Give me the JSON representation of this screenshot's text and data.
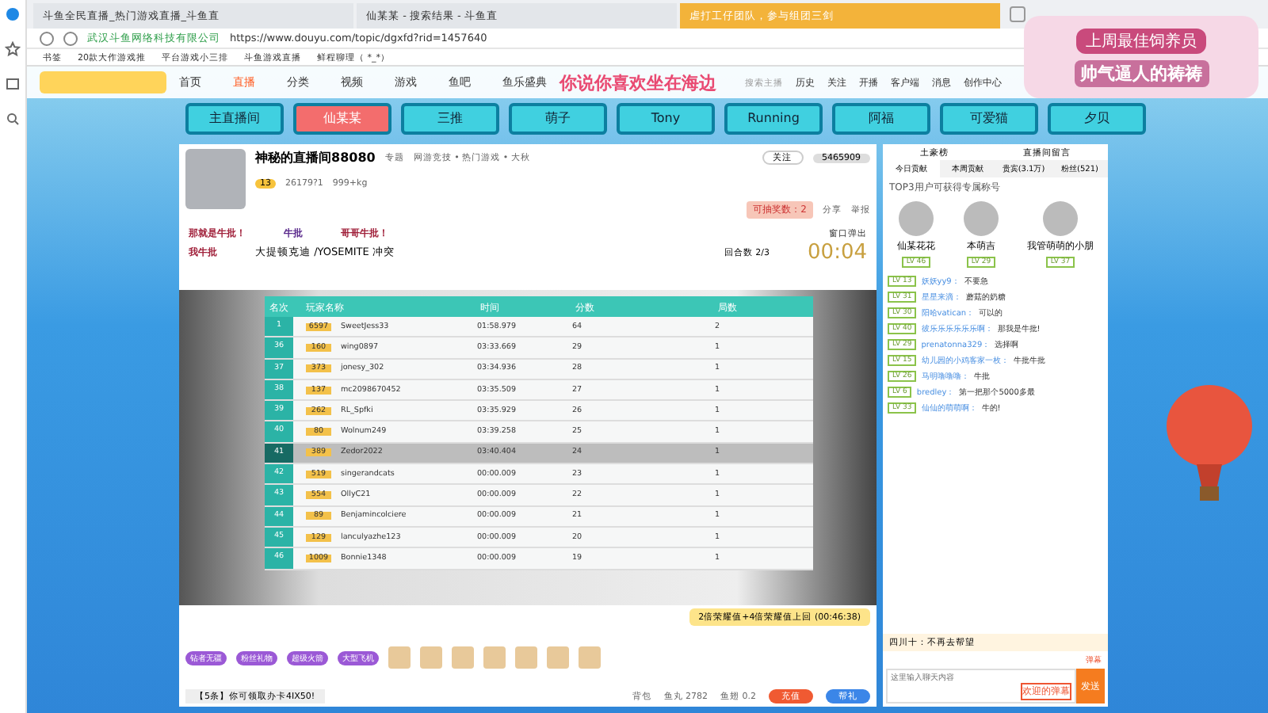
{
  "browser": {
    "tabs": [
      {
        "title": "斗鱼全民直播_热门游戏直播_斗鱼直",
        "selected": false
      },
      {
        "title": "仙某某 - 搜索结果 - 斗鱼直",
        "selected": false
      },
      {
        "title": "虐打工仔团队，参与组团三剑",
        "selected": true
      }
    ],
    "site_owner": "武汉斗鱼网络科技有限公司",
    "url": "https://www.douyu.com/topic/dgxfd?rid=1457640",
    "bookmarks": [
      "书签",
      "20款大作游戏推",
      "平台游戏小三排",
      "斗鱼游戏直播",
      "鲜程聊理（ *_*）"
    ]
  },
  "overlay": {
    "caption": "你说你喜欢坐在海边",
    "badge_title": "上周最佳饲养员",
    "badge_name": "帅气逼人的祷祷"
  },
  "site_nav": {
    "items": [
      {
        "label": "首页",
        "selected": false
      },
      {
        "label": "直播",
        "selected": true
      },
      {
        "label": "分类",
        "selected": false
      },
      {
        "label": "视频",
        "selected": false
      },
      {
        "label": "游戏",
        "selected": false
      },
      {
        "label": "鱼吧",
        "selected": false
      },
      {
        "label": "鱼乐盛典",
        "selected": false
      }
    ],
    "search_placeholder": "搜索主播",
    "actions": [
      "历史",
      "关注",
      "开播",
      "客户端",
      "消息",
      "创作中心"
    ]
  },
  "anchor_tabs": [
    {
      "label": "主直播间",
      "selected": false
    },
    {
      "label": "仙某某",
      "selected": true
    },
    {
      "label": "三推",
      "selected": false
    },
    {
      "label": "萌子",
      "selected": false
    },
    {
      "label": "Tony",
      "selected": false
    },
    {
      "label": "Running",
      "selected": false
    },
    {
      "label": "阿福",
      "selected": false
    },
    {
      "label": "可爱猫",
      "selected": false
    },
    {
      "label": "夕贝",
      "selected": false
    }
  ],
  "room": {
    "title": "神秘的直播间88080",
    "tag": "专题",
    "category": "网游竞技 • 热门游戏 • 大秋",
    "level": "13",
    "heat": "26179?1",
    "follow": "关注",
    "report": "举报",
    "share": "分享",
    "fans_count": "5465909",
    "stat_weight": "999+kg",
    "notice": "可抽奖数：2"
  },
  "game": {
    "banner_left": "那就是牛批！",
    "banner_mid": "牛批",
    "banner_right": "哥哥牛批！",
    "label_left": "我牛批",
    "map": "大提顿克迪 /YOSEMITE 冲突",
    "round": "回合数 2/3",
    "timer": "00:04",
    "popout": "窗口弹出",
    "columns": [
      "名次",
      "玩家名称",
      "时间",
      "分数",
      "局数"
    ],
    "rows": [
      {
        "rank": "1",
        "level": "6597",
        "name": "SweetJess33",
        "time": "01:58.979",
        "score": "64",
        "count": "2",
        "selected": false
      },
      {
        "rank": "36",
        "level": "160",
        "name": "wing0897",
        "time": "03:33.669",
        "score": "29",
        "count": "1",
        "selected": false
      },
      {
        "rank": "37",
        "level": "373",
        "name": "jonesy_302",
        "time": "03:34.936",
        "score": "28",
        "count": "1",
        "selected": false
      },
      {
        "rank": "38",
        "level": "137",
        "name": "mc2098670452",
        "time": "03:35.509",
        "score": "27",
        "count": "1",
        "selected": false
      },
      {
        "rank": "39",
        "level": "262",
        "name": "RL_Spfki",
        "time": "03:35.929",
        "score": "26",
        "count": "1",
        "selected": false
      },
      {
        "rank": "40",
        "level": "80",
        "name": "Wolnum249",
        "time": "03:39.258",
        "score": "25",
        "count": "1",
        "selected": false
      },
      {
        "rank": "41",
        "level": "389",
        "name": "Zedor2022",
        "time": "03:40.404",
        "score": "24",
        "count": "1",
        "selected": true
      },
      {
        "rank": "42",
        "level": "519",
        "name": "singerandcats",
        "time": "00:00.009",
        "score": "23",
        "count": "1",
        "selected": false
      },
      {
        "rank": "43",
        "level": "554",
        "name": "OllyC21",
        "time": "00:00.009",
        "score": "22",
        "count": "1",
        "selected": false
      },
      {
        "rank": "44",
        "level": "89",
        "name": "Benjamincolciere",
        "time": "00:00.009",
        "score": "21",
        "count": "1",
        "selected": false
      },
      {
        "rank": "45",
        "level": "129",
        "name": "lanculyazhe123",
        "time": "00:00.009",
        "score": "20",
        "count": "1",
        "selected": false
      },
      {
        "rank": "46",
        "level": "1009",
        "name": "Bonnie1348",
        "time": "00:00.009",
        "score": "19",
        "count": "1",
        "selected": false
      }
    ]
  },
  "gift_bar": {
    "promo": "2倍荣耀值+4倍荣耀值上回 (00:46:38)",
    "notice": "【5条】你可领取办卡4IX50!",
    "gifts": [
      "钻者无疆",
      "粉丝礼物",
      "超级火箭",
      "大型飞机"
    ],
    "backpack": "背包",
    "coins": "鱼丸 2782",
    "points": "鱼翅 0.2",
    "charge": "充值",
    "send_gift": "帮礼"
  },
  "chat": {
    "header_left": "土豪榜",
    "header_right": "直播间留言",
    "tabs": [
      {
        "label": "今日贡献",
        "selected": true
      },
      {
        "label": "本周贡献",
        "selected": false
      },
      {
        "label": "贵宾(3.1万)",
        "selected": false
      },
      {
        "label": "粉丝(521)",
        "selected": false
      }
    ],
    "top_note": "TOP3用户可获得专属称号",
    "top3": [
      {
        "name": "仙某花花",
        "level": "LV 46"
      },
      {
        "name": "本萌吉",
        "level": "LV 29"
      },
      {
        "name": "我管萌萌的小朋",
        "level": "LV 37"
      }
    ],
    "messages": [
      {
        "level": "LV 13",
        "user": "妖妖yy9：",
        "text": "不要急"
      },
      {
        "level": "LV 31",
        "user": "星星来滴：",
        "text": "蘑菇的奶糖"
      },
      {
        "level": "LV 30",
        "user": "阳哈vatican：",
        "text": "可以的"
      },
      {
        "level": "LV 40",
        "user": "彼乐乐乐乐乐乐啊：",
        "text": "那我是牛批!"
      },
      {
        "level": "LV 29",
        "user": "prenatonna329：",
        "text": "选择啊"
      },
      {
        "level": "LV 15",
        "user": "幼儿园的小鸡客家一枚：",
        "text": "牛批牛批"
      },
      {
        "level": "LV 26",
        "user": "马明噜噜噜：",
        "text": "牛批"
      },
      {
        "level": "LV 6",
        "user": "bredley：",
        "text": "第一把那个5000多最"
      },
      {
        "level": "LV 33",
        "user": "仙仙的萌萌啊：",
        "text": "牛的!"
      }
    ],
    "pinned": "四川十：不再去帮望",
    "input_placeholder": "这里输入聊天内容",
    "send": "发送",
    "barrage": "弹幕",
    "color_barrage": "欢迎的弹幕"
  }
}
